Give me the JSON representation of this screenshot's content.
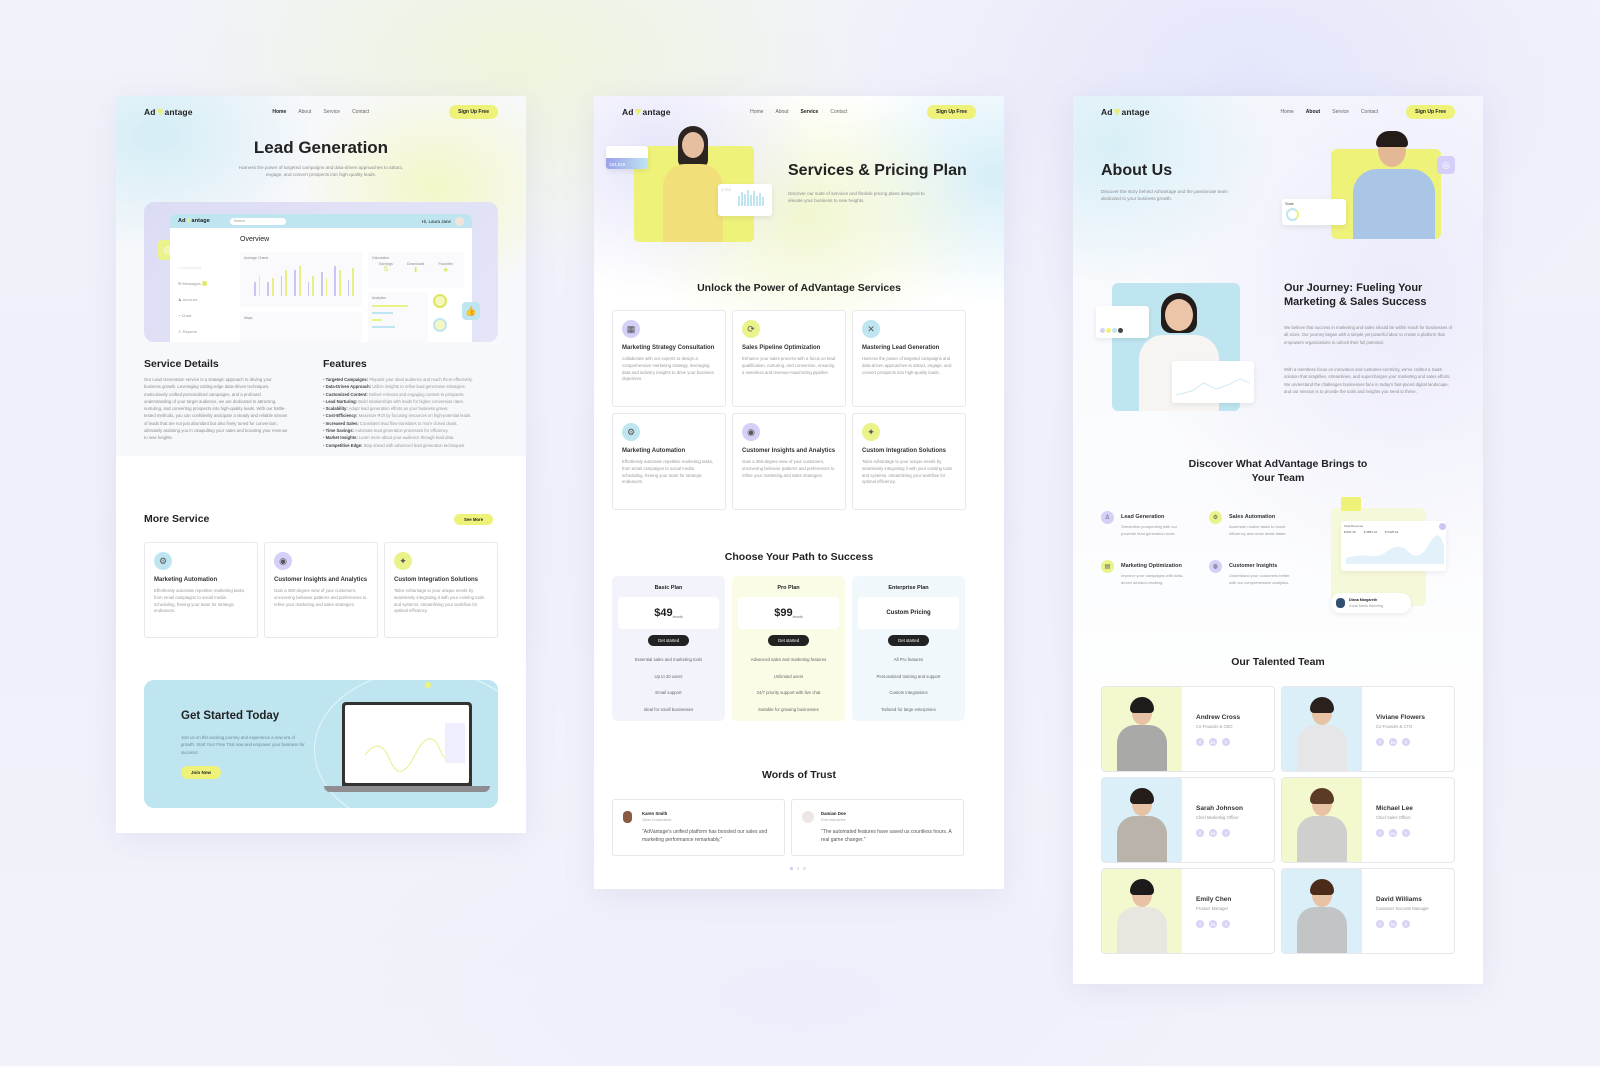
{
  "brand": {
    "logo_left": "Ad",
    "logo_right": "antage",
    "accent_yellow": "#eef279",
    "accent_blue": "#bfe5f1",
    "accent_lavender": "#d4d0f7"
  },
  "nav": {
    "links": [
      "Home",
      "About",
      "Service",
      "Contact"
    ],
    "signup": "Sign Up Free"
  },
  "lead_page": {
    "title": "Lead Generation",
    "subtitle": "Harness the power of targeted campaigns and data-driven approaches to attract, engage, and convert prospects into high-quality leads.",
    "dashboard": {
      "search_placeholder": "Search",
      "greeting": "Hi, Laura Jane",
      "overview": "Overview",
      "sidebar": [
        "Dashboard",
        "Messages",
        "Account",
        "Chart",
        "Reports"
      ],
      "messages_badge": "2",
      "chart_title": "Average Charts",
      "calc_title": "Calculation",
      "calc_items": [
        "Earnings",
        "Downloads",
        "Favorites"
      ],
      "analytics_title": "Analytics",
      "maps_title": "Maps"
    },
    "service_details_title": "Service Details",
    "service_details_body": "Our Lead Generation service is a strategic approach to driving your business growth. Leveraging cutting-edge data-driven techniques, meticulously crafted personalized campaigns, and a profound understanding of your target audience, we are dedicated to attracting, nurturing, and converting prospects into high-quality leads. With our battle-tested methods, you can confidently anticipate a steady and reliable stream of leads that are not just abundant but also finely tuned for conversion, ultimately assisting you in catapulting your sales and boosting your revenue to new heights.",
    "features_title": "Features",
    "features": [
      {
        "name": "Targeted Campaigns:",
        "desc": "Pinpoint your ideal audience and reach them effectively."
      },
      {
        "name": "Data-Driven Approach:",
        "desc": "Utilize insights to refine lead generation strategies."
      },
      {
        "name": "Customized Content:",
        "desc": "Deliver relevant and engaging content to prospects."
      },
      {
        "name": "Lead Nurturing:",
        "desc": "Build relationships with leads for higher conversion rates."
      },
      {
        "name": "Scalability:",
        "desc": "Adapt lead generation efforts as your business grows."
      },
      {
        "name": "Cost-Efficiency:",
        "desc": "Maximize ROI by focusing resources on high-potential leads."
      },
      {
        "name": "Increased Sales:",
        "desc": "Consistent lead flow translates to more closed deals."
      },
      {
        "name": "Time Savings:",
        "desc": "Automate lead generation processes for efficiency."
      },
      {
        "name": "Market Insights:",
        "desc": "Learn more about your audience through lead data."
      },
      {
        "name": "Competitive Edge:",
        "desc": "Stay ahead with advanced lead generation techniques."
      }
    ],
    "more_service_title": "More Service",
    "see_more": "See More",
    "more_services": [
      {
        "title": "Marketing Automation",
        "desc": "Effortlessly automate repetitive marketing tasks, from email campaigns to social media scheduling, freeing your team for strategic endeavors."
      },
      {
        "title": "Customer Insights and Analytics",
        "desc": "Gain a 360-degree view of your customers, uncovering behavior patterns and preferences to refine your marketing and sales strategies."
      },
      {
        "title": "Custom Integration Solutions",
        "desc": "Tailor AdVantage to your unique needs by seamlessly integrating it with your existing tools and systems, streamlining your workflow for optimal efficiency."
      }
    ],
    "cta_title": "Get Started Today",
    "cta_body": "Join us on this exciting journey and experience a new era of growth. Start Your Free Trial now and empower your business for success!",
    "cta_button": "Join Now"
  },
  "service_page": {
    "title": "Services & Pricing Plan",
    "subtitle": "Discover our suite of services and flexible pricing plans designed to elevate your business to new heights.",
    "hero_stat_1": "154,829",
    "hero_stat_2": "3,553",
    "services_title": "Unlock the Power of AdVantage Services",
    "services": [
      {
        "title": "Marketing Strategy Consultation",
        "desc": "Collaborate with our experts to design a comprehensive marketing strategy, leveraging data and industry insights to drive your business objectives."
      },
      {
        "title": "Sales Pipeline Optimization",
        "desc": "Enhance your sales process with a focus on lead qualification, nurturing, and conversion, ensuring a seamless and revenue-maximizing pipeline."
      },
      {
        "title": "Mastering Lead Generation",
        "desc": "Harness the power of targeted campaigns and data-driven approaches to attract, engage, and convert prospects into high-quality leads."
      },
      {
        "title": "Marketing Automation",
        "desc": "Effortlessly automate repetitive marketing tasks, from email campaigns to social media scheduling, freeing your team for strategic endeavors."
      },
      {
        "title": "Customer Insights and Analytics",
        "desc": "Gain a 360-degree view of your customers, uncovering behavior patterns and preferences to refine your marketing and sales strategies."
      },
      {
        "title": "Custom Integration Solutions",
        "desc": "Tailor AdVantage to your unique needs by seamlessly integrating it with your existing tools and systems, streamlining your workflow for optimal efficiency."
      }
    ],
    "pricing_title": "Choose Your Path to Success",
    "plans": [
      {
        "name": "Basic Plan",
        "price": "$49",
        "period": "/month",
        "cta": "Get started",
        "features": [
          "Essential sales and marketing tools",
          "Up to 20 users",
          "Email support",
          "Ideal for small businesses"
        ]
      },
      {
        "name": "Pro Plan",
        "price": "$99",
        "period": "/month",
        "cta": "Get started",
        "features": [
          "Advanced sales and marketing features",
          "Unlimited users",
          "24/7 priority support with live chat",
          "Suitable for growing businesses"
        ]
      },
      {
        "name": "Enterprise Plan",
        "price": "Custom Pricing",
        "period": "",
        "cta": "Get started",
        "features": [
          "All Pro features",
          "Personalized training and support",
          "Custom integrations",
          "Tailored for large enterprises"
        ]
      }
    ],
    "trust_title": "Words of Trust",
    "testimonials": [
      {
        "name": "Karen Smith",
        "company": "Steel Corporation",
        "quote": "\"AdVantage's unified platform has boosted our sales and marketing performance remarkably.\""
      },
      {
        "name": "Damian Doe",
        "company": "Doe Industries",
        "quote": "\"The automated features have saved us countless hours. A real game changer.\""
      }
    ]
  },
  "about_page": {
    "title": "About Us",
    "subtitle": "Discover the story behind AdVantage and the passionate team dedicated to your business growth.",
    "stats_label": "Stats",
    "journey_title": "Our Journey: Fueling Your Marketing & Sales Success",
    "journey_p1": "We believe that success in marketing and sales should be within reach for businesses of all sizes. Our journey began with a simple yet powerful idea: to create a platform that empowers organizations to unlock their full potential.",
    "journey_p2": "With a relentless focus on innovation and customer-centricity, we've crafted a SaaS solution that simplifies, streamlines, and supercharges your marketing and sales efforts. We understand the challenges businesses face in today's fast-paced digital landscape, and our mission is to provide the tools and insights you need to thrive.",
    "discover_title": "Discover What AdVantage Brings to Your Team",
    "benefits": [
      {
        "title": "Lead Generation",
        "desc": "Streamline prospecting with our powerful lead generation tools."
      },
      {
        "title": "Sales Automation",
        "desc": "Automate routine tasks to boost efficiency and close deals faster."
      },
      {
        "title": "Marketing Optimization",
        "desc": "Improve your campaigns with data-driven decision-making."
      },
      {
        "title": "Customer Insights",
        "desc": "Understand your customers better with our comprehensive analytics."
      }
    ],
    "revenue_label": "Total Revenue",
    "revenue_values": [
      "$ 831.35",
      "$ 4584.12",
      "$ 5325.91"
    ],
    "profile_name": "Diana Margareth",
    "profile_role": "Social Media Marketing",
    "team_title": "Our Talented Team",
    "team": [
      {
        "name": "Andrew Cross",
        "role": "Co-Founder & CEO"
      },
      {
        "name": "Viviane Flowers",
        "role": "Co-Founder & CTO"
      },
      {
        "name": "Sarah Johnson",
        "role": "Chief Marketing Officer"
      },
      {
        "name": "Michael Lee",
        "role": "Chief Sales Officer"
      },
      {
        "name": "Emily Chen",
        "role": "Product Manager"
      },
      {
        "name": "David Williams",
        "role": "Customer Success Manager"
      }
    ],
    "social_icons": [
      "f",
      "in",
      "t"
    ]
  }
}
